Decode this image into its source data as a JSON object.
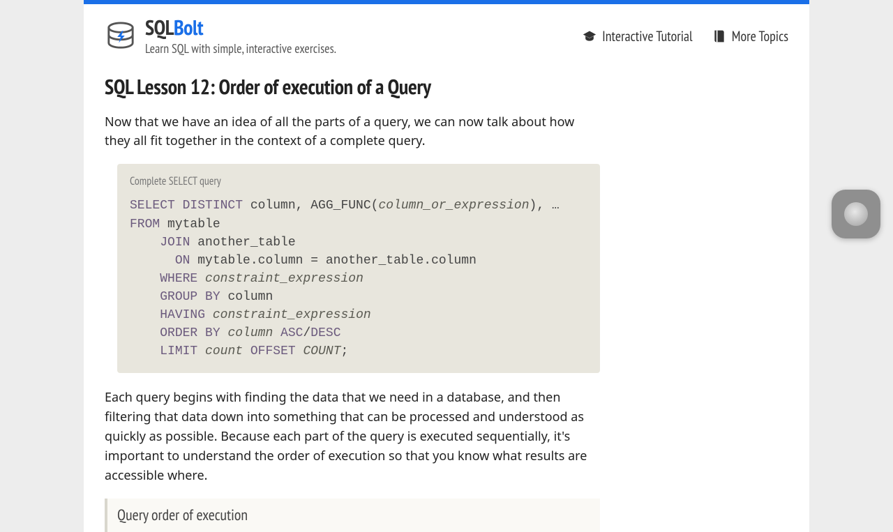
{
  "brand": {
    "sql": "SQL",
    "bolt": "Bolt"
  },
  "tagline": "Learn SQL with simple, interactive exercises.",
  "nav": {
    "tutorial": "Interactive Tutorial",
    "more": "More Topics"
  },
  "lesson": {
    "title": "SQL Lesson 12: Order of execution of a Query",
    "intro": "Now that we have an idea of all the parts of a query, we can now talk about how they all fit together in the context of a complete query.",
    "codebox_title": "Complete SELECT query",
    "code": {
      "l1_kw1": "SELECT DISTINCT",
      "l1_txt1": " column, AGG_FUNC(",
      "l1_ital": "column_or_expression",
      "l1_txt2": "), …",
      "l2_kw": "FROM",
      "l2_txt": " mytable",
      "l3_pad": "    ",
      "l3_kw": "JOIN",
      "l3_txt": " another_table",
      "l4_pad": "      ",
      "l4_kw": "ON",
      "l4_txt": " mytable.column = another_table.column",
      "l5_pad": "    ",
      "l5_kw": "WHERE",
      "l5_sp": " ",
      "l5_ital": "constraint_expression",
      "l6_pad": "    ",
      "l6_kw": "GROUP BY",
      "l6_txt": " column",
      "l7_pad": "    ",
      "l7_kw": "HAVING",
      "l7_sp": " ",
      "l7_ital": "constraint_expression",
      "l8_pad": "    ",
      "l8_kw": "ORDER BY",
      "l8_sp": " ",
      "l8_ital": "column",
      "l8_sp2": " ",
      "l8_kw2": "ASC",
      "l8_slash": "/",
      "l8_kw3": "DESC",
      "l9_pad": "    ",
      "l9_kw": "LIMIT",
      "l9_sp": " ",
      "l9_ital": "count",
      "l9_sp2": " ",
      "l9_kw2": "OFFSET",
      "l9_sp3": " ",
      "l9_ital2": "COUNT",
      "l9_semi": ";"
    },
    "para2": "Each query begins with finding the data that we need in a database, and then filtering that data down into something that can be processed and understood as quickly as possible. Because each part of the query is executed sequentially, it's important to understand the order of execution so that you know what results are accessible where.",
    "section_header": "Query order of execution"
  }
}
